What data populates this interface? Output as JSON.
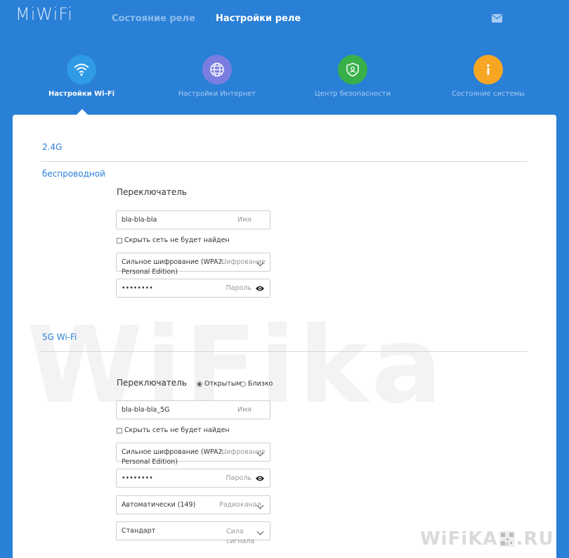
{
  "header": {
    "logo": "MiWiFi",
    "nav": [
      {
        "label": "Состояние реле",
        "active": false
      },
      {
        "label": "Настройки реле",
        "active": true
      }
    ]
  },
  "icon_nav": [
    {
      "label": "Настройки Wi-Fi",
      "icon": "wifi-icon",
      "color": "#2f9be6",
      "active": true
    },
    {
      "label": "Настройки Интернет",
      "icon": "globe-icon",
      "color": "#7a7de0",
      "active": false
    },
    {
      "label": "Центр безопасности",
      "icon": "shield-icon",
      "color": "#38b04a",
      "active": false
    },
    {
      "label": "Состояние системы",
      "icon": "info-icon",
      "color": "#f6a623",
      "active": false
    }
  ],
  "band_24": {
    "title": "2.4G",
    "subtitle": "беспроводной",
    "switch_label": "Переключатель",
    "name_value": "bla-bla-bla",
    "name_placeholder": "Имя",
    "hide_label": "Скрыть сеть не будет найден",
    "encryption_value": "Сильное шифрование (WPA2 Personal Edition)",
    "encryption_placeholder": "Шифрование",
    "password_value": "••••••••",
    "password_placeholder": "Пароль"
  },
  "band_5": {
    "title": "5G Wi-Fi",
    "switch_label": "Переключатель",
    "radio_on": "Открытым",
    "radio_off": "Близко",
    "name_value": "bla-bla-bla_5G",
    "name_placeholder": "Имя",
    "hide_label": "Скрыть сеть не будет найден",
    "encryption_value": "Сильное шифрование (WPA2 Personal Edition)",
    "encryption_placeholder": "Шифрование",
    "password_value": "••••••••",
    "password_placeholder": "Пароль",
    "channel_value": "Автоматически (149)",
    "channel_placeholder": "Радиоканал",
    "strength_value": "Стандарт",
    "strength_placeholder": "Сила сигнала"
  },
  "watermark": {
    "background_text": "WiFika",
    "corner_left": "WiFiKA",
    "corner_right": ".RU"
  }
}
